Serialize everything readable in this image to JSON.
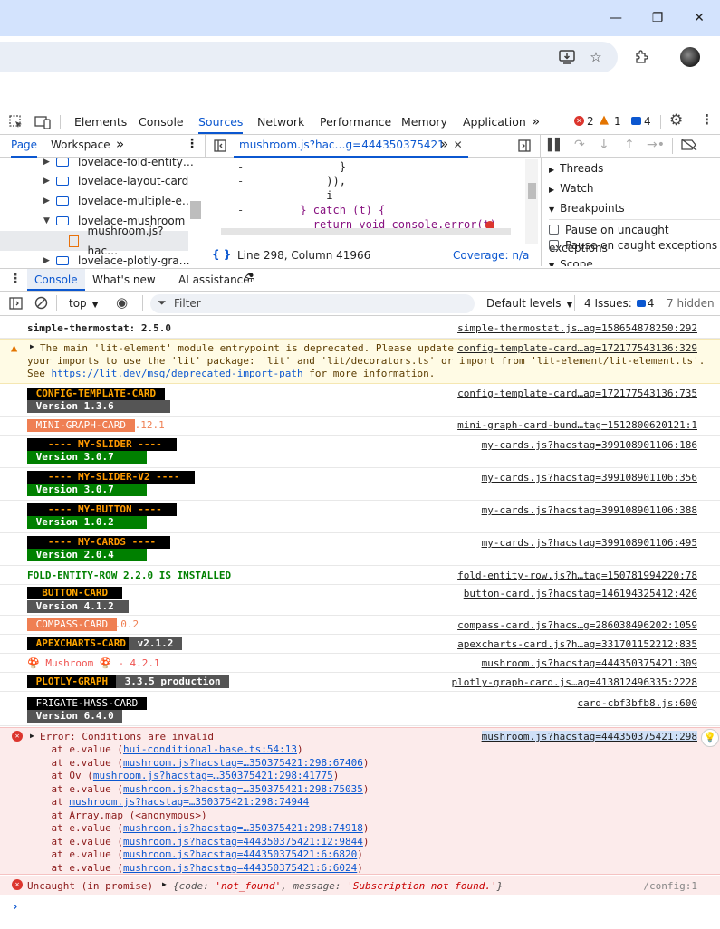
{
  "window_controls": {
    "minimize": "—",
    "maximize": "❐",
    "close": "✕"
  },
  "devtools": {
    "tabs": [
      "Elements",
      "Console",
      "Sources",
      "Network",
      "Performance",
      "Memory",
      "Application"
    ],
    "active_tab": "Sources",
    "more": "»",
    "error_count": "2",
    "warning_count": "1",
    "info_count": "4"
  },
  "sources": {
    "nav_tabs": [
      "Page",
      "Workspace"
    ],
    "more": "»",
    "open_file": "mushroom.js?hac…g=444350375421",
    "tree": [
      {
        "label": "lovelace-fold-entity…",
        "type": "folder",
        "expanded": false
      },
      {
        "label": "lovelace-layout-card",
        "type": "folder",
        "expanded": false
      },
      {
        "label": "lovelace-multiple-e…",
        "type": "folder",
        "expanded": false
      },
      {
        "label": "lovelace-mushroom",
        "type": "folder",
        "expanded": true
      },
      {
        "label": "mushroom.js?hac…",
        "type": "file",
        "expanded": false
      },
      {
        "label": "lovelace-plotly-gra…",
        "type": "folder",
        "expanded": false
      }
    ],
    "code": [
      {
        "marker": "-",
        "text": "            }"
      },
      {
        "marker": "-",
        "text": "          )),"
      },
      {
        "marker": "-",
        "text": "          i"
      },
      {
        "marker": "-",
        "text": "      } catch (t) {"
      },
      {
        "marker": "-",
        "text": "        return void console.error(t)"
      }
    ],
    "status": "Line 298, Column 41966",
    "coverage": "Coverage: n/a",
    "debugger": {
      "sections": [
        "Threads",
        "Watch",
        "Breakpoints"
      ],
      "checkboxes": [
        "Pause on uncaught exceptions",
        "Pause on caught exceptions"
      ],
      "scope": "Scope"
    }
  },
  "drawer": {
    "tabs": [
      "Console",
      "What's new",
      "AI assistance"
    ],
    "active": "Console"
  },
  "console_toolbar": {
    "context": "top",
    "filter_placeholder": "Filter",
    "levels": "Default levels",
    "issues_label": "4 Issues:",
    "issues_count": "4",
    "hidden": "7 hidden"
  },
  "messages": {
    "thermostat": {
      "text": "simple-thermostat: 2.5.0",
      "src": "simple-thermostat.js…ag=158654878250:292"
    },
    "warning": {
      "line1": "The main 'lit-element' module entrypoint is deprecated. Please update",
      "line2": "your imports to use the 'lit' package: 'lit' and 'lit/decorators.ts' or import from 'lit-element/lit-element.ts'.",
      "line3_pre": "See ",
      "line3_link": "https://lit.dev/msg/deprecated-import-path",
      "line3_post": " for more information.",
      "src": "config-template-card…ag=172177543136:329"
    },
    "config_template": {
      "name": " CONFIG-TEMPLATE-CARD ",
      "version": " Version 1.3.6         ",
      "src": "config-template-card…ag=172177543136:735"
    },
    "mini_graph": {
      "name": " MINI-GRAPH-CARD ",
      "version": " 0.12.1",
      "src": "mini-graph-card-bund…tag=1512800620121:1"
    },
    "my_slider": {
      "name": "   ---- MY-SLIDER ----  ",
      "version": " Version 3.0.7     ",
      "src": "my-cards.js?hacstag=399108901106:186"
    },
    "my_slider_v2": {
      "name": "   ---- MY-SLIDER-V2 ----  ",
      "version": " Version 3.0.7     ",
      "src": "my-cards.js?hacstag=399108901106:356"
    },
    "my_button": {
      "name": "   ---- MY-BUTTON ----  ",
      "version": " Version 1.0.2     ",
      "src": "my-cards.js?hacstag=399108901106:388"
    },
    "my_cards": {
      "name": "   ---- MY-CARDS ----  ",
      "version": " Version 2.0.4     ",
      "src": "my-cards.js?hacstag=399108901106:495"
    },
    "fold_entity": {
      "text": "FOLD-ENTITY-ROW 2.2.0 IS INSTALLED",
      "src": "fold-entity-row.js?h…tag=150781994220:78"
    },
    "button_card": {
      "name": "  BUTTON-CARD  ",
      "version": " Version 4.1.2  ",
      "src": "button-card.js?hacstag=146194325412:426"
    },
    "compass": {
      "name": " COMPASS-CARD ",
      "version": "  2.0.2",
      "src": "compass-card.js?hacs…g=286038496202:1059"
    },
    "apexcharts": {
      "name": " APEXCHARTS-CARD ",
      "version": " v2.1.2 ",
      "src": "apexcharts-card.js?h…ag=331701152212:835"
    },
    "mushroom": {
      "text": "🍄 Mushroom 🍄 - 4.2.1",
      "src": "mushroom.js?hacstag=444350375421:309"
    },
    "plotly": {
      "name": " PLOTLY-GRAPH ",
      "version": " 3.3.5 production ",
      "src": "plotly-graph-card.js…ag=413812496335:2228"
    },
    "frigate": {
      "name": " FRIGATE-HASS-CARD ",
      "version": " Version 6.4.0 ",
      "src": "card-cbf3bfb8.js:600"
    },
    "error": {
      "title": "Error: Conditions are invalid",
      "src": "mushroom.js?hacstag=444350375421:298",
      "stack": [
        {
          "pre": "    at e.value (",
          "link": "hui-conditional-base.ts:54:13",
          "post": ")"
        },
        {
          "pre": "    at e.value (",
          "link": "mushroom.js?hacstag=…350375421:298:67406",
          "post": ")"
        },
        {
          "pre": "    at Ov (",
          "link": "mushroom.js?hacstag=…350375421:298:41775",
          "post": ")"
        },
        {
          "pre": "    at e.value (",
          "link": "mushroom.js?hacstag=…350375421:298:75035",
          "post": ")"
        },
        {
          "pre": "    at ",
          "link": "mushroom.js?hacstag=…350375421:298:74944",
          "post": ""
        },
        {
          "pre": "    at Array.map (<anonymous>)",
          "link": "",
          "post": ""
        },
        {
          "pre": "    at e.value (",
          "link": "mushroom.js?hacstag=…350375421:298:74918",
          "post": ")"
        },
        {
          "pre": "    at e.value (",
          "link": "mushroom.js?hacstag=444350375421:12:9844",
          "post": ")"
        },
        {
          "pre": "    at e.value (",
          "link": "mushroom.js?hacstag=444350375421:6:6820",
          "post": ")"
        },
        {
          "pre": "    at e.value (",
          "link": "mushroom.js?hacstag=444350375421:6:6024",
          "post": ")"
        }
      ]
    },
    "uncaught": {
      "label": "Uncaught (in promise)",
      "obj_open": "{",
      "k1": "code: ",
      "v1": "'not_found'",
      "sep": ", ",
      "k2": "message: ",
      "v2": "'Subscription not found.'",
      "obj_close": "}",
      "src": "/config:1"
    },
    "prompt": "›"
  },
  "colors": {
    "accent": "#0b57d0",
    "titlebar": "#d3e3fd",
    "error_bg": "#fcebeb",
    "warning_bg": "#fffbe5",
    "error_red": "#dc362e",
    "warning_orange": "#e37400"
  }
}
